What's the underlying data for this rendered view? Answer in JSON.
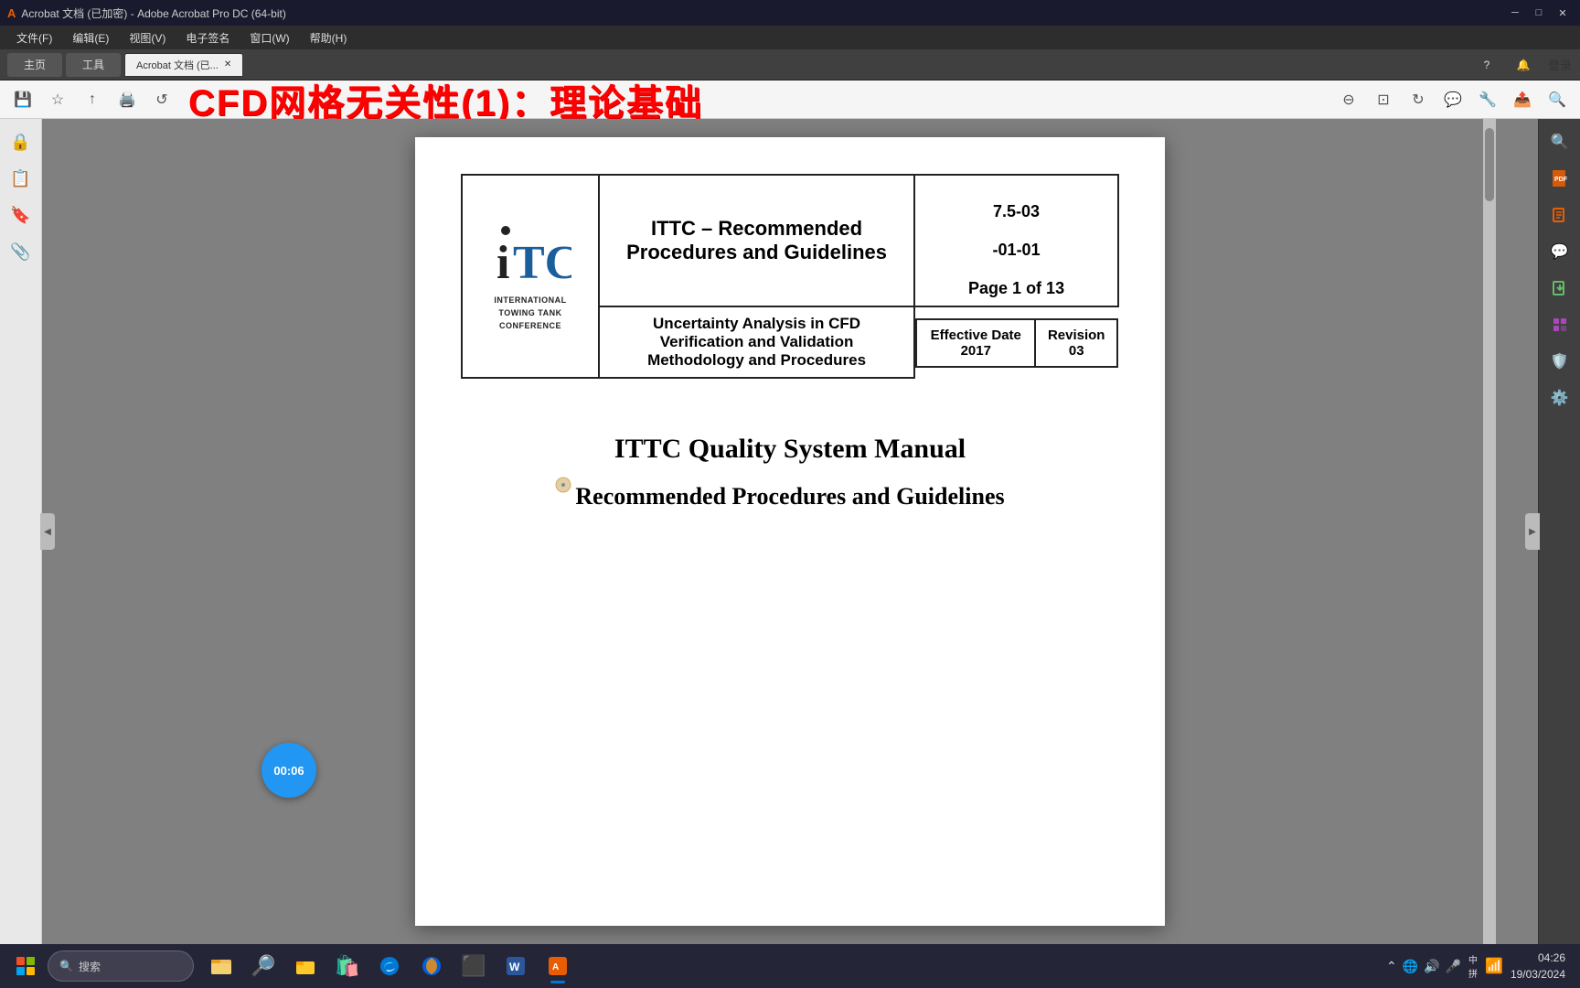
{
  "window": {
    "title": "Acrobat 文档 (已加密) - Adobe Acrobat Pro DC (64-bit)",
    "controls": [
      "minimize",
      "maximize",
      "close"
    ]
  },
  "menu": {
    "items": [
      "文件(F)",
      "编辑(E)",
      "视图(V)",
      "电子签名",
      "窗口(W)",
      "帮助(H)"
    ]
  },
  "tabs": {
    "nav_left": "主页",
    "nav_right": "工具",
    "current_tab": "Acrobat 文档 (已...",
    "top_right": [
      "?",
      "🔔",
      "登录"
    ]
  },
  "overlay_title": "CFD网格无关性(1)：理论基础",
  "ittc_table": {
    "logo_lines": [
      "INTERNATIONAL",
      "TOWING TANK",
      "CONFERENCE"
    ],
    "main_title_line1": "ITTC – Recommended",
    "main_title_line2": "Procedures and Guidelines",
    "doc_number_line1": "7.5-03",
    "doc_number_line2": "-01-01",
    "doc_number_line3": "Page 1 of 13",
    "subtitle_line1": "Uncertainty Analysis in CFD",
    "subtitle_line2": "Verification and Validation",
    "subtitle_line3": "Methodology and Procedures",
    "effective_date_label": "Effective Date",
    "effective_date_value": "2017",
    "revision_label": "Revision",
    "revision_value": "03"
  },
  "pdf_content": {
    "main_title": "ITTC Quality System Manual",
    "subtitle": "Recommended Procedures and Guidelines"
  },
  "timer": {
    "value": "00:06"
  },
  "left_panel_icons": [
    "🔒",
    "📋",
    "🔖",
    "📎"
  ],
  "right_panel": {
    "icons": [
      {
        "name": "search",
        "symbol": "🔍",
        "color": "#555"
      },
      {
        "name": "document",
        "symbol": "📄",
        "color": "#e85d04"
      },
      {
        "name": "edit",
        "symbol": "✏️",
        "color": "#555"
      },
      {
        "name": "share",
        "symbol": "📤",
        "color": "#555"
      },
      {
        "name": "comment",
        "symbol": "💬",
        "color": "#4fc3f7"
      },
      {
        "name": "export",
        "symbol": "⬇️",
        "color": "#66bb6a"
      },
      {
        "name": "organize",
        "symbol": "📊",
        "color": "#ab47bc"
      },
      {
        "name": "protect",
        "symbol": "🛡️",
        "color": "#555"
      },
      {
        "name": "settings",
        "symbol": "⚙️",
        "color": "#555"
      }
    ]
  },
  "taskbar": {
    "search_placeholder": "搜索",
    "apps": [
      {
        "name": "explorer",
        "symbol": "🗂️"
      },
      {
        "name": "chrome",
        "symbol": "🌐"
      },
      {
        "name": "edge",
        "symbol": "🔵"
      },
      {
        "name": "file-manager",
        "symbol": "📁"
      },
      {
        "name": "store",
        "symbol": "🛍️"
      },
      {
        "name": "firefox",
        "symbol": "🦊"
      },
      {
        "name": "terminal",
        "symbol": "⌨️"
      },
      {
        "name": "word",
        "symbol": "📝"
      },
      {
        "name": "acrobat",
        "symbol": "📕"
      }
    ],
    "clock": "04:26",
    "date": "19/03/2024",
    "lang": "中",
    "pinyin": "拼"
  }
}
